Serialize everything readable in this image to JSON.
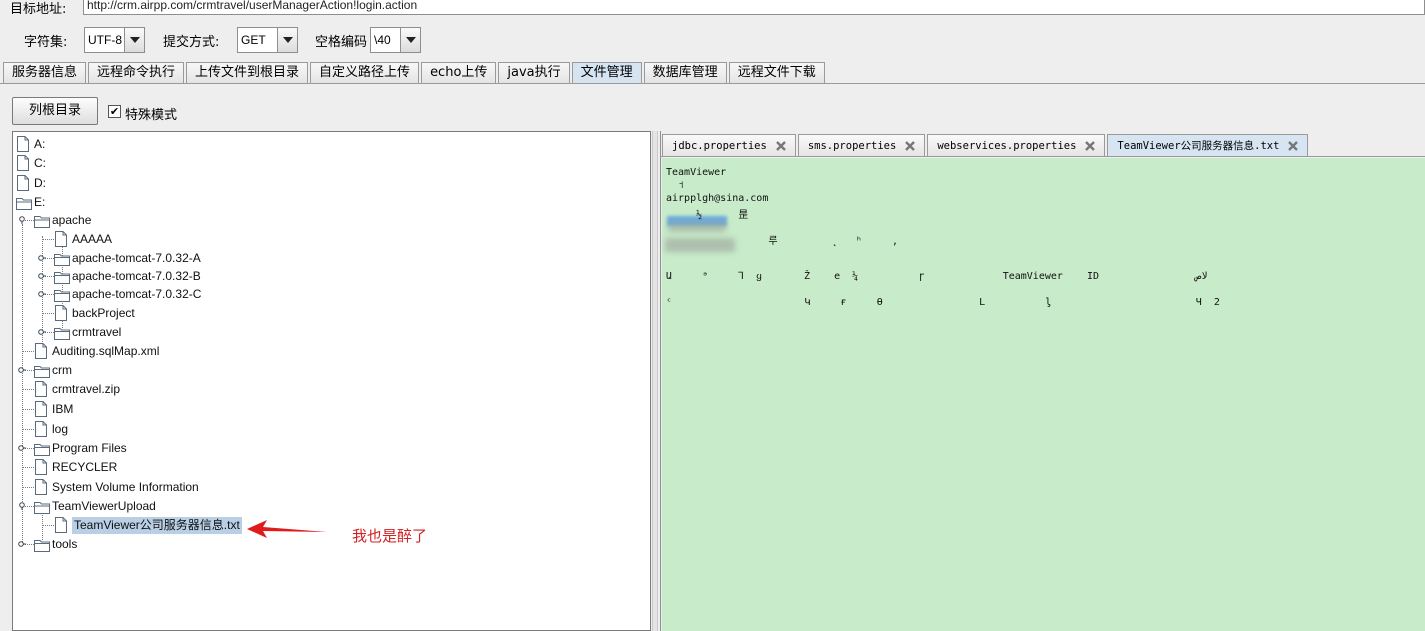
{
  "target": {
    "label": "目标地址:",
    "url": "http://crm.airpp.com/crmtravel/userManagerAction!login.action"
  },
  "options": {
    "charset_label": "字符集:",
    "charset_value": "UTF-8",
    "method_label": "提交方式:",
    "method_value": "GET",
    "space_label": "空格编码",
    "space_value": "\\40"
  },
  "main_tabs": [
    {
      "label": "服务器信息"
    },
    {
      "label": "远程命令执行"
    },
    {
      "label": "上传文件到根目录"
    },
    {
      "label": "自定义路径上传"
    },
    {
      "label": "echo上传"
    },
    {
      "label": "java执行"
    },
    {
      "label": "文件管理",
      "active": true
    },
    {
      "label": "数据库管理"
    },
    {
      "label": "远程文件下载"
    }
  ],
  "toolbar": {
    "list_root_label": "列根目录",
    "special_mode_label": "特殊模式",
    "special_mode_checked": true,
    "check_mark": "✔"
  },
  "tree": {
    "nodes": [
      {
        "label": "A:",
        "type": "file"
      },
      {
        "label": "C:",
        "type": "file"
      },
      {
        "label": "D:",
        "type": "file"
      },
      {
        "label": "E:",
        "type": "folder-open"
      },
      {
        "label": "apache",
        "type": "folder-open"
      },
      {
        "label": "AAAAA",
        "type": "file"
      },
      {
        "label": "apache-tomcat-7.0.32-A",
        "type": "folder"
      },
      {
        "label": "apache-tomcat-7.0.32-B",
        "type": "folder"
      },
      {
        "label": "apache-tomcat-7.0.32-C",
        "type": "folder"
      },
      {
        "label": "backProject",
        "type": "file"
      },
      {
        "label": "crmtravel",
        "type": "folder"
      },
      {
        "label": "Auditing.sqlMap.xml",
        "type": "file"
      },
      {
        "label": "crm",
        "type": "folder"
      },
      {
        "label": "crmtravel.zip",
        "type": "file"
      },
      {
        "label": "IBM",
        "type": "file"
      },
      {
        "label": "log",
        "type": "file"
      },
      {
        "label": "Program Files",
        "type": "folder"
      },
      {
        "label": "RECYCLER",
        "type": "file"
      },
      {
        "label": "System Volume Information",
        "type": "file"
      },
      {
        "label": "TeamViewerUpload",
        "type": "folder-open"
      },
      {
        "label": "TeamViewer公司服务器信息.txt",
        "type": "file",
        "selected": true
      },
      {
        "label": "tools",
        "type": "folder"
      }
    ]
  },
  "annotation": {
    "text": "我也是醉了",
    "color": "#d32020"
  },
  "editor_tabs": [
    {
      "label": "jdbc.properties"
    },
    {
      "label": "sms.properties"
    },
    {
      "label": "webservices.properties"
    },
    {
      "label": "TeamViewer公司服务器信息.txt",
      "active": true
    }
  ],
  "editor": {
    "background": "#c8ebc9",
    "lines": [
      "TeamViewer",
      "  ˦",
      "airpplgh@sina.com",
      "     ½      昰",
      "",
      "                 루         ˛   ʰ     ,",
      "",
      "Ա     ᵊ     Ꞁ  ყ       Ž    e  ¼          ɼ             TeamViewer    ID                لاص",
      "",
      "ᶜ                      Կ     ғ     Ɵ                L          ᶅ                        Ч  2"
    ]
  }
}
